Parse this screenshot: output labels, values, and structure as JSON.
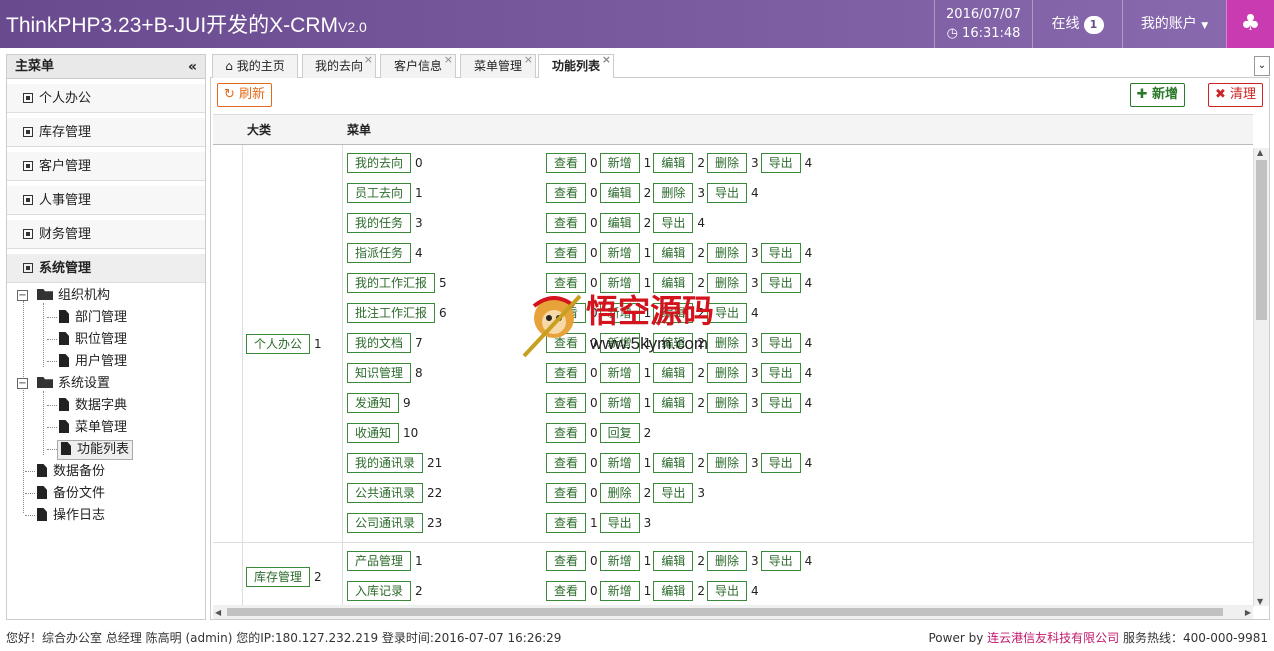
{
  "header": {
    "brand": "ThinkPHP3.23+B-JUI开发的X-CRM",
    "version": "V2.0",
    "date": "2016/07/07",
    "time": "16:31:48",
    "online_label": "在线",
    "online_count": "1",
    "account_label": "我的账户"
  },
  "sidebar": {
    "title": "主菜单",
    "collapse_icon": "«",
    "accordions": [
      {
        "label": "个人办公"
      },
      {
        "label": "库存管理"
      },
      {
        "label": "客户管理"
      },
      {
        "label": "人事管理"
      },
      {
        "label": "财务管理"
      },
      {
        "label": "系统管理"
      }
    ],
    "tree": {
      "org": "组织机构",
      "dept": "部门管理",
      "position": "职位管理",
      "users": "用户管理",
      "settings": "系统设置",
      "dict": "数据字典",
      "menu": "菜单管理",
      "funcs": "功能列表",
      "backup": "数据备份",
      "files": "备份文件",
      "logs": "操作日志"
    }
  },
  "tabs": [
    {
      "label": "我的主页",
      "icon": "home-icon"
    },
    {
      "label": "我的去向"
    },
    {
      "label": "客户信息"
    },
    {
      "label": "菜单管理"
    },
    {
      "label": "功能列表"
    }
  ],
  "toolbar": {
    "refresh": "刷新",
    "add": "新增",
    "clear": "清理"
  },
  "table": {
    "col_category": "大类",
    "col_menu": "菜单",
    "groups": [
      {
        "category": "个人办公",
        "category_num": "1",
        "rows": [
          {
            "menu": "我的去向",
            "num": "0",
            "actions": [
              [
                "查看",
                "0"
              ],
              [
                "新增",
                "1"
              ],
              [
                "编辑",
                "2"
              ],
              [
                "删除",
                "3"
              ],
              [
                "导出",
                "4"
              ]
            ]
          },
          {
            "menu": "员工去向",
            "num": "1",
            "actions": [
              [
                "查看",
                "0"
              ],
              [
                "编辑",
                "2"
              ],
              [
                "删除",
                "3"
              ],
              [
                "导出",
                "4"
              ]
            ]
          },
          {
            "menu": "我的任务",
            "num": "3",
            "actions": [
              [
                "查看",
                "0"
              ],
              [
                "编辑",
                "2"
              ],
              [
                "导出",
                "4"
              ]
            ]
          },
          {
            "menu": "指派任务",
            "num": "4",
            "actions": [
              [
                "查看",
                "0"
              ],
              [
                "新增",
                "1"
              ],
              [
                "编辑",
                "2"
              ],
              [
                "删除",
                "3"
              ],
              [
                "导出",
                "4"
              ]
            ]
          },
          {
            "menu": "我的工作汇报",
            "num": "5",
            "actions": [
              [
                "查看",
                "0"
              ],
              [
                "新增",
                "1"
              ],
              [
                "编辑",
                "2"
              ],
              [
                "删除",
                "3"
              ],
              [
                "导出",
                "4"
              ]
            ]
          },
          {
            "menu": "批注工作汇报",
            "num": "6",
            "actions": [
              [
                "查看",
                "0"
              ],
              [
                "新增",
                "1"
              ],
              [
                "编辑",
                "2"
              ],
              [
                "导出",
                "4"
              ]
            ]
          },
          {
            "menu": "我的文档",
            "num": "7",
            "actions": [
              [
                "查看",
                "0"
              ],
              [
                "新增",
                "1"
              ],
              [
                "编辑",
                "2"
              ],
              [
                "删除",
                "3"
              ],
              [
                "导出",
                "4"
              ]
            ]
          },
          {
            "menu": "知识管理",
            "num": "8",
            "actions": [
              [
                "查看",
                "0"
              ],
              [
                "新增",
                "1"
              ],
              [
                "编辑",
                "2"
              ],
              [
                "删除",
                "3"
              ],
              [
                "导出",
                "4"
              ]
            ]
          },
          {
            "menu": "发通知",
            "num": "9",
            "actions": [
              [
                "查看",
                "0"
              ],
              [
                "新增",
                "1"
              ],
              [
                "编辑",
                "2"
              ],
              [
                "删除",
                "3"
              ],
              [
                "导出",
                "4"
              ]
            ]
          },
          {
            "menu": "收通知",
            "num": "10",
            "actions": [
              [
                "查看",
                "0"
              ],
              [
                "回复",
                "2"
              ]
            ]
          },
          {
            "menu": "我的通讯录",
            "num": "21",
            "actions": [
              [
                "查看",
                "0"
              ],
              [
                "新增",
                "1"
              ],
              [
                "编辑",
                "2"
              ],
              [
                "删除",
                "3"
              ],
              [
                "导出",
                "4"
              ]
            ]
          },
          {
            "menu": "公共通讯录",
            "num": "22",
            "actions": [
              [
                "查看",
                "0"
              ],
              [
                "删除",
                "2"
              ],
              [
                "导出",
                "3"
              ]
            ]
          },
          {
            "menu": "公司通讯录",
            "num": "23",
            "actions": [
              [
                "查看",
                "1"
              ],
              [
                "导出",
                "3"
              ]
            ]
          }
        ]
      },
      {
        "category": "库存管理",
        "category_num": "2",
        "rows": [
          {
            "menu": "产品管理",
            "num": "1",
            "actions": [
              [
                "查看",
                "0"
              ],
              [
                "新增",
                "1"
              ],
              [
                "编辑",
                "2"
              ],
              [
                "删除",
                "3"
              ],
              [
                "导出",
                "4"
              ]
            ]
          },
          {
            "menu": "入库记录",
            "num": "2",
            "actions": [
              [
                "查看",
                "0"
              ],
              [
                "新增",
                "1"
              ],
              [
                "编辑",
                "2"
              ],
              [
                "导出",
                "4"
              ]
            ]
          }
        ]
      }
    ]
  },
  "footer": {
    "left": "您好！综合办公室 总经理 陈高明 (admin) 您的IP:180.127.232.219 登录时间:2016-07-07 16:26:29",
    "power": "Power by",
    "company": "连云港信友科技有限公司",
    "hotline": "服务热线：400-000-9981"
  },
  "watermark": {
    "cn": "悟空源码",
    "en": "www.5kym.com"
  },
  "colors": {
    "header": "#7b5ba0",
    "theme_button": "#c93bb1",
    "green_border": "#3a8a3a",
    "refresh_orange": "#e36a1a",
    "clear_red": "#cc2222"
  }
}
